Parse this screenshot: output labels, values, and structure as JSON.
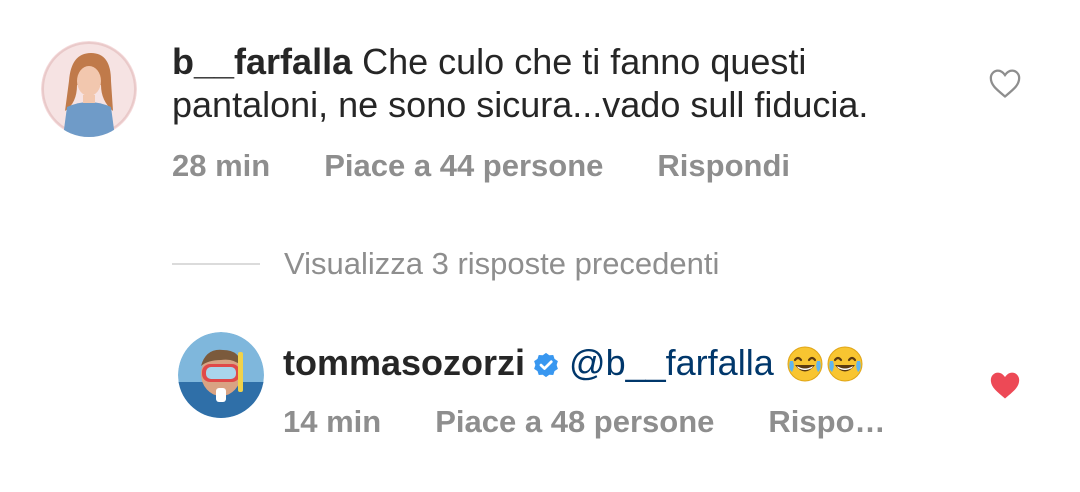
{
  "comment": {
    "username": "b__farfalla",
    "text_line1": "Che culo che ti fanno questi",
    "text_line2": "pantaloni, ne sono sicura...vado sull fiducia.",
    "time": "28 min",
    "likes": "Piace a 44 persone",
    "reply": "Rispondi",
    "liked": false
  },
  "view_replies": {
    "label": "Visualizza 3 risposte precedenti"
  },
  "reply": {
    "username": "tommasozorzi",
    "verified": true,
    "mention": "@b__farfalla",
    "emojis": [
      "face-with-tears-of-joy",
      "face-with-tears-of-joy"
    ],
    "time": "14 min",
    "likes": "Piace a 48 persone",
    "reply": "Rispo…",
    "liked": true
  },
  "colors": {
    "text": "#262626",
    "secondary": "#8e8e8e",
    "mention": "#00376b",
    "verified": "#3897f0",
    "heart_liked": "#ed4956"
  }
}
